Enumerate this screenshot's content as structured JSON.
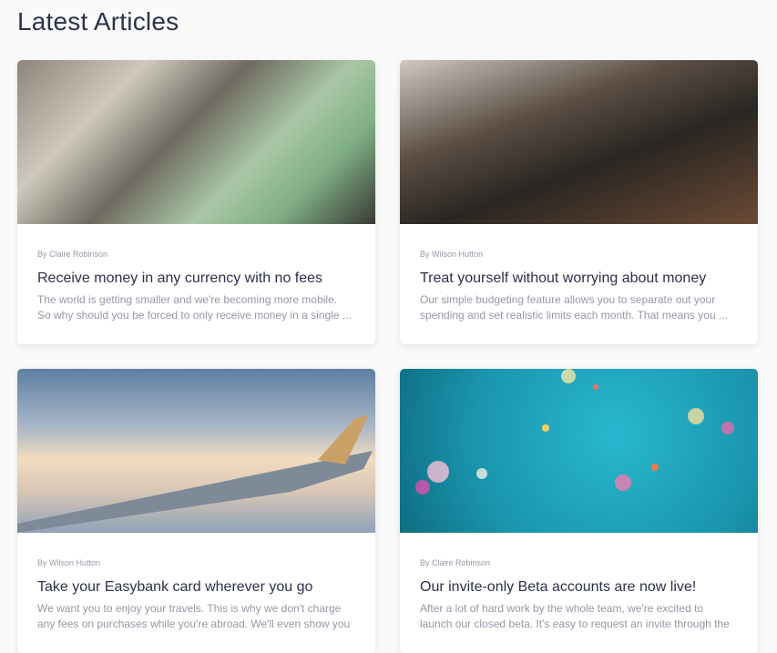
{
  "page_title": "Latest Articles",
  "articles": [
    {
      "author": "By Claire Robinson",
      "title": "Receive money in any currency with no fees",
      "excerpt": [
        "The world is getting smaller and we're becoming more mobile.",
        "So why should you be forced to only receive money in a single ..."
      ],
      "image": "money-bills-image"
    },
    {
      "author": "By Wilson Hutton",
      "title": "Treat yourself without worrying about money",
      "excerpt": [
        "Our simple budgeting feature allows you to separate out your",
        "spending and set realistic limits each month. That means you ..."
      ],
      "image": "restaurant-plate-image"
    },
    {
      "author": "By Wilson Hutton",
      "title": "Take your Easybank card wherever you go",
      "excerpt": [
        "We want you to enjoy your travels. This is why we don't charge",
        "any fees on purchases while you're abroad. We'll even show you"
      ],
      "image": "airplane-wing-image"
    },
    {
      "author": "By Claire Robinson",
      "title": "Our invite-only Beta accounts are now live!",
      "excerpt": [
        "After a lot of hard work by the whole team, we're excited to",
        "launch our closed beta. It's easy to request an invite through the"
      ],
      "image": "confetti-image"
    }
  ]
}
